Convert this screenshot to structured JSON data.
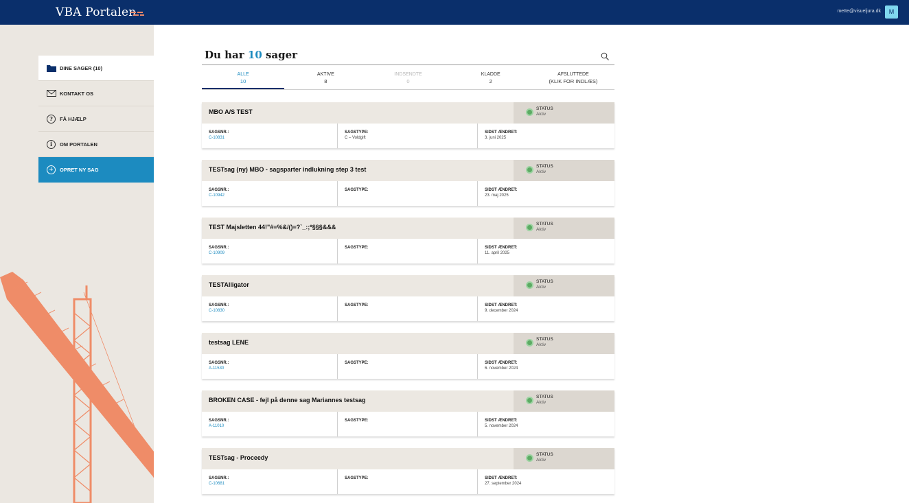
{
  "header": {
    "logo_text": "VBA Portalen",
    "user_email": "mette@visueljura.dk",
    "avatar_initial": "M",
    "colors": {
      "topbar": "#0a2f6b",
      "accent": "#1c8bc0",
      "logo_mark": "#e8886a"
    }
  },
  "sidebar": {
    "items": [
      {
        "label": "DINE SAGER (10)",
        "icon": "folder-icon"
      },
      {
        "label": "KONTAKT OS",
        "icon": "envelope-icon"
      },
      {
        "label": "FÅ HJÆLP",
        "icon": "question-icon",
        "glyph": "?"
      },
      {
        "label": "OM PORTALEN",
        "icon": "info-icon",
        "glyph": "i"
      },
      {
        "label": "OPRET NY SAG",
        "icon": "plus-circle-icon",
        "glyph": "+"
      }
    ]
  },
  "main": {
    "heading_prefix": "Du har ",
    "heading_count": "10",
    "heading_suffix": " sager",
    "tabs": [
      {
        "label": "ALLE",
        "count": "10"
      },
      {
        "label": "AKTIVE",
        "count": "8"
      },
      {
        "label": "INDSENDTE",
        "count": "0"
      },
      {
        "label": "KLADDE",
        "count": "2"
      },
      {
        "label": "AFSLUTTEDE",
        "count": "(KLIK FOR INDLÆS)"
      }
    ],
    "case_labels": {
      "status": "STATUS",
      "case_no": "SAGSNR.:",
      "case_type": "SAGSTYPE:",
      "last_changed": "SIDST ÆNDRET:"
    },
    "cases": [
      {
        "title": "MBO A/S TEST",
        "status": "Aktiv",
        "case_no": "C-10831",
        "case_type": "C – Voldgift",
        "last_changed": "3. juni 2025"
      },
      {
        "title": "TESTsag (ny) MBO - sagsparter indlukning step 3 test",
        "status": "Aktiv",
        "case_no": "C-10942",
        "case_type": "",
        "last_changed": "23. maj 2025"
      },
      {
        "title": "TEST Majsletten 44!\"#=%&/()=?`_:;*§§§&&&",
        "status": "Aktiv",
        "case_no": "C-10909",
        "case_type": "",
        "last_changed": "11. april 2025"
      },
      {
        "title": "TESTAlligator",
        "status": "Aktiv",
        "case_no": "C-10830",
        "case_type": "",
        "last_changed": "9. december 2024"
      },
      {
        "title": "testsag LENE",
        "status": "Aktiv",
        "case_no": "A-11530",
        "case_type": "",
        "last_changed": "6. november 2024"
      },
      {
        "title": "BROKEN CASE - fejl på denne sag Mariannes testsag",
        "status": "Aktiv",
        "case_no": "A-11010",
        "case_type": "",
        "last_changed": "5. november 2024"
      },
      {
        "title": "TESTsag - Proceedy",
        "status": "Aktiv",
        "case_no": "C-10681",
        "case_type": "",
        "last_changed": "27. september 2024"
      }
    ]
  }
}
